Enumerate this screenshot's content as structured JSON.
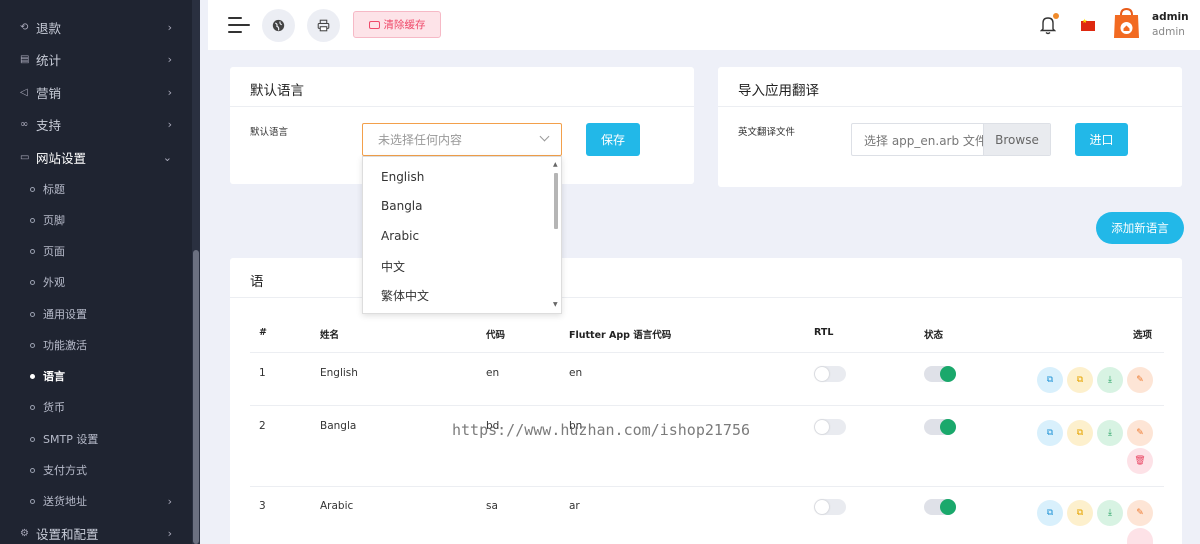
{
  "sidebar": {
    "items": [
      {
        "label": "退款"
      },
      {
        "label": "统计"
      },
      {
        "label": "营销"
      },
      {
        "label": "支持"
      },
      {
        "label": "网站设置"
      },
      {
        "label": "设置和配置"
      }
    ],
    "subitems": [
      {
        "label": "标题"
      },
      {
        "label": "页脚"
      },
      {
        "label": "页面"
      },
      {
        "label": "外观"
      },
      {
        "label": "通用设置"
      },
      {
        "label": "功能激活"
      },
      {
        "label": "语言"
      },
      {
        "label": "货币"
      },
      {
        "label": "SMTP 设置"
      },
      {
        "label": "支付方式"
      },
      {
        "label": "送货地址"
      }
    ]
  },
  "topbar": {
    "clear_cache": "清除缓存",
    "admin_name": "admin",
    "admin_role": "admin"
  },
  "default_lang": {
    "title": "默认语言",
    "label": "默认语言",
    "placeholder": "未选择任何内容",
    "save": "保存",
    "options": [
      "English",
      "Bangla",
      "Arabic",
      "中文",
      "繁体中文"
    ]
  },
  "import": {
    "title": "导入应用翻译",
    "label": "英文翻译文件",
    "placeholder": "选择 app_en.arb 文件",
    "browse": "Browse",
    "submit": "进口"
  },
  "add_language": "添加新语言",
  "table": {
    "title": "语",
    "headers": [
      "#",
      "姓名",
      "代码",
      "Flutter App 语言代码",
      "RTL",
      "状态",
      "选项"
    ],
    "rows": [
      {
        "num": "1",
        "name": "English",
        "code": "en",
        "app_code": "en"
      },
      {
        "num": "2",
        "name": "Bangla",
        "code": "bd",
        "app_code": "bn"
      },
      {
        "num": "3",
        "name": "Arabic",
        "code": "sa",
        "app_code": "ar"
      }
    ]
  },
  "watermark": "https://www.huzhan.com/ishop21756",
  "colors": {
    "sidebar_bg": "#1f2431",
    "accent": "#22b8e8",
    "status_on": "#1aa86b",
    "danger": "#ef4a6a"
  }
}
